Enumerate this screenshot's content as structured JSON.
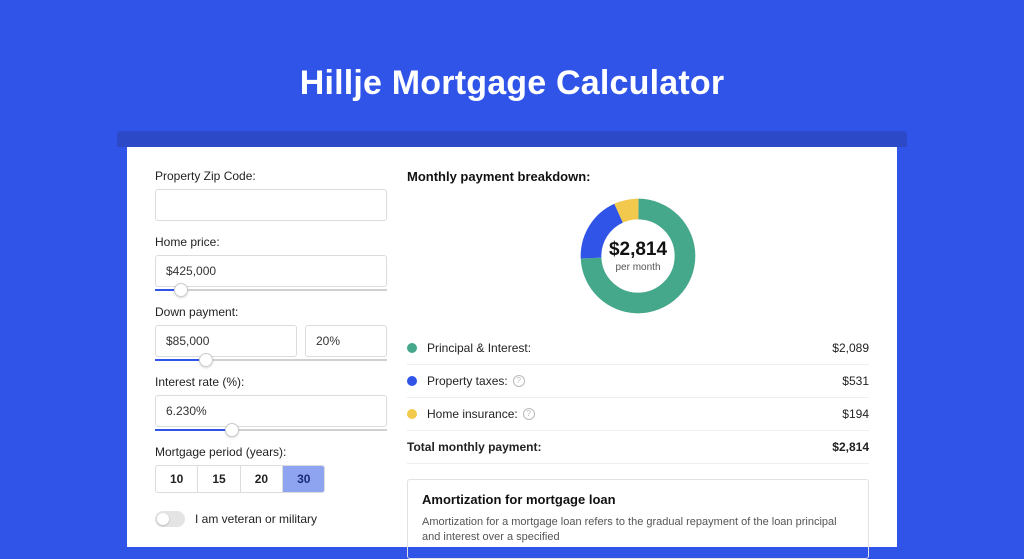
{
  "title": "Hillje Mortgage Calculator",
  "form": {
    "zip_label": "Property Zip Code:",
    "zip_value": "",
    "home_price_label": "Home price:",
    "home_price_value": "$425,000",
    "home_price_slider_pct": 8,
    "down_payment_label": "Down payment:",
    "down_payment_value": "$85,000",
    "down_payment_pct_value": "20%",
    "down_payment_slider_pct": 19,
    "interest_label": "Interest rate (%):",
    "interest_value": "6.230%",
    "interest_slider_pct": 30,
    "period_label": "Mortgage period (years):",
    "periods": [
      "10",
      "15",
      "20",
      "30"
    ],
    "period_selected_index": 3,
    "veteran_label": "I am veteran or military",
    "veteran_on": false
  },
  "breakdown": {
    "header": "Monthly payment breakdown:",
    "amount": "$2,814",
    "sub": "per month",
    "items": [
      {
        "label": "Principal & Interest:",
        "value": "$2,089",
        "color": "#45a88a",
        "has_info": false
      },
      {
        "label": "Property taxes:",
        "value": "$531",
        "color": "#3054e8",
        "has_info": true
      },
      {
        "label": "Home insurance:",
        "value": "$194",
        "color": "#f2c94c",
        "has_info": true
      }
    ],
    "total_label": "Total monthly payment:",
    "total_value": "$2,814"
  },
  "chart_data": {
    "type": "pie",
    "title": "Monthly payment breakdown",
    "series": [
      {
        "name": "Principal & Interest",
        "value": 2089,
        "color": "#45a88a"
      },
      {
        "name": "Property taxes",
        "value": 531,
        "color": "#3054e8"
      },
      {
        "name": "Home insurance",
        "value": 194,
        "color": "#f2c94c"
      }
    ],
    "total": 2814,
    "center_label": "$2,814",
    "center_sub": "per month"
  },
  "amort": {
    "title": "Amortization for mortgage loan",
    "text": "Amortization for a mortgage loan refers to the gradual repayment of the loan principal and interest over a specified"
  }
}
